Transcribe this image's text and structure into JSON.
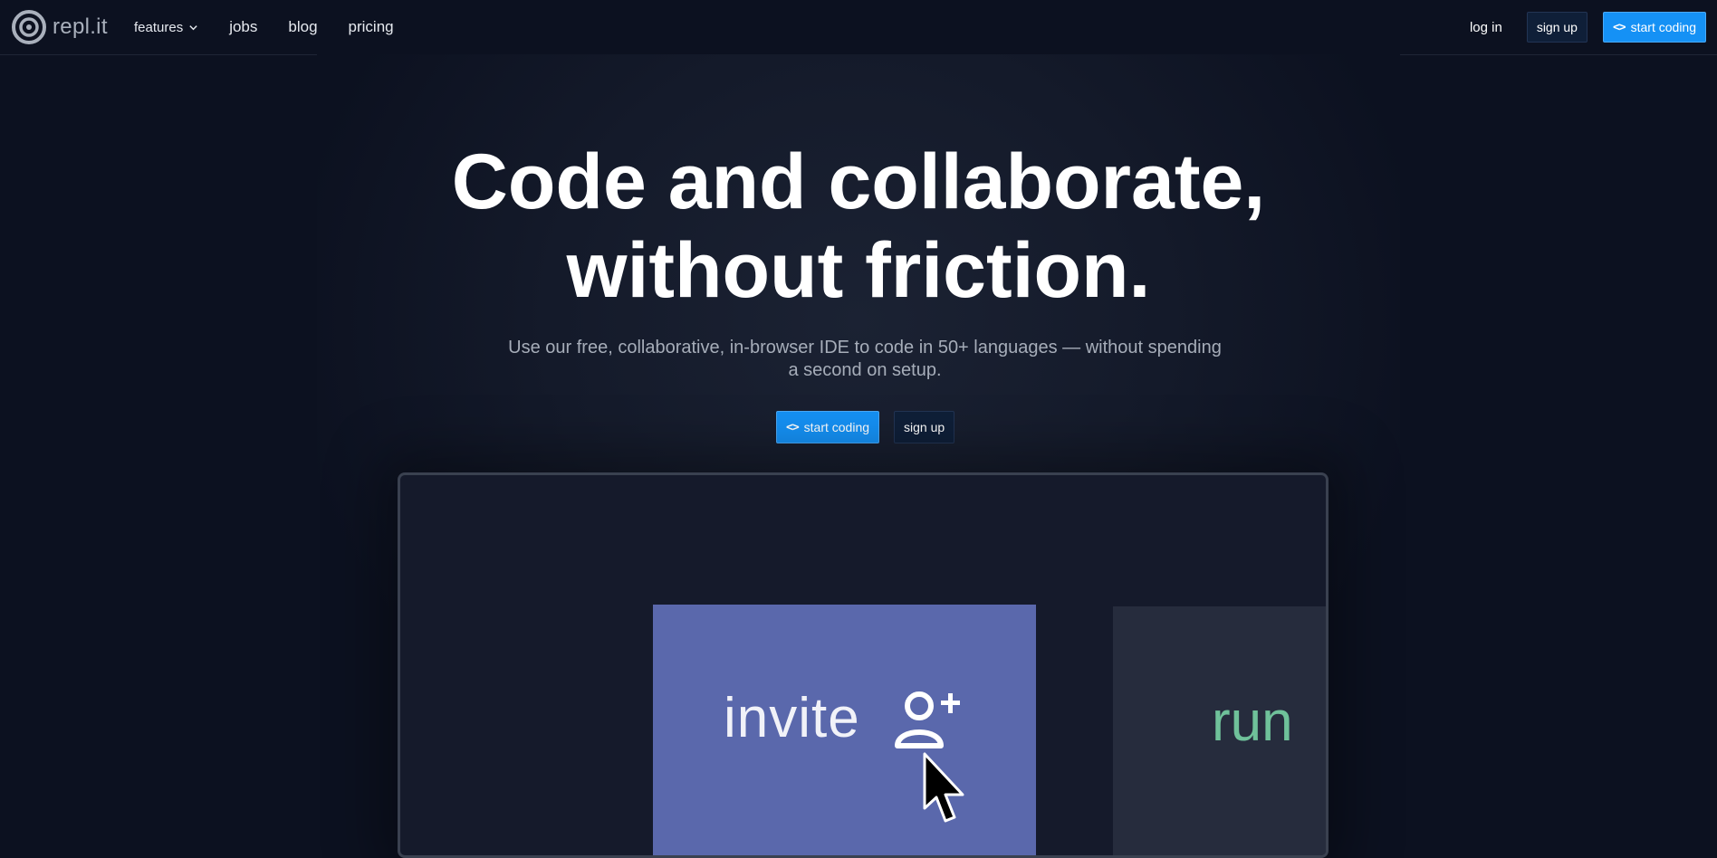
{
  "nav": {
    "logo_text": "repl.it",
    "links": [
      {
        "label": "features"
      },
      {
        "label": "jobs"
      },
      {
        "label": "blog"
      },
      {
        "label": "pricing"
      }
    ],
    "login_label": "log in",
    "signup_label": "sign up",
    "start_coding_label": "start coding"
  },
  "hero": {
    "title_line1": "Code and collaborate,",
    "title_line2": "without friction.",
    "subtitle": "Use our free, collaborative, in-browser IDE to code in 50+ languages — without spending a second on setup.",
    "start_coding_label": "start coding",
    "signup_label": "sign up"
  },
  "demo": {
    "invite_label": "invite",
    "run_label": "run"
  },
  "colors": {
    "background": "#0c1120",
    "accent_blue": "#1591f5",
    "invite_card": "#5a68ac",
    "run_text": "#6fc19a"
  },
  "icons": [
    "replit-logo-icon",
    "chevron-down-icon",
    "code-brackets-icon",
    "add-user-icon",
    "mouse-cursor-icon"
  ]
}
